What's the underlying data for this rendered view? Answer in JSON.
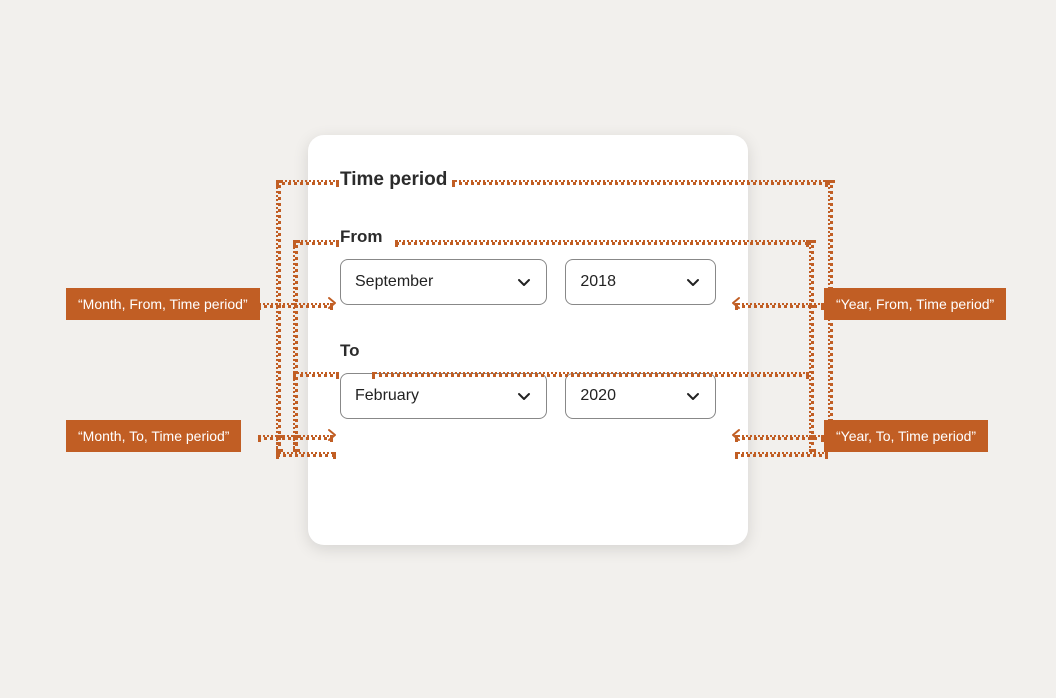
{
  "card": {
    "title": "Time period",
    "from": {
      "label": "From",
      "month": "September",
      "year": "2018"
    },
    "to": {
      "label": "To",
      "month": "February",
      "year": "2020"
    }
  },
  "annotations": {
    "from_month": "“Month, From, Time period”",
    "from_year": "“Year, From, Time period”",
    "to_month": "“Month, To, Time period”",
    "to_year": "“Year, To, Time period”"
  }
}
